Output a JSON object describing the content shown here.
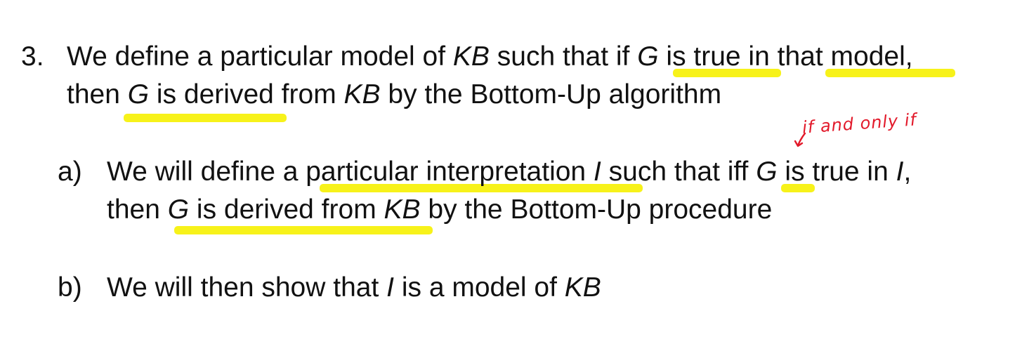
{
  "item3": {
    "number": "3.",
    "line1": {
      "a": "We define a particular model of ",
      "kb": "KB",
      "b": " such that if ",
      "g": "G",
      "c": " is true in that model,"
    },
    "line2": {
      "a": "then ",
      "g": "G",
      "b": " is derived from ",
      "kb": "KB",
      "c": " by the Bottom-Up algorithm"
    }
  },
  "item_a": {
    "label": "a)",
    "line1": {
      "a": "We will define a particular interpretation ",
      "i": "I",
      "b": " such that iff ",
      "g": "G",
      "c": " is true in ",
      "i2": "I",
      "d": ","
    },
    "line2": {
      "a": "then ",
      "g": "G",
      "b": " is derived from ",
      "kb": "KB",
      "c": " by the Bottom-Up procedure"
    }
  },
  "item_b": {
    "label": "b)",
    "line1": {
      "a": "We will then show that ",
      "i": "I",
      "b": " is a model of ",
      "kb": "KB"
    }
  },
  "annotation": {
    "text": "if and only if"
  },
  "colors": {
    "highlight": "#f7f21a",
    "annotation": "#e2192a"
  }
}
